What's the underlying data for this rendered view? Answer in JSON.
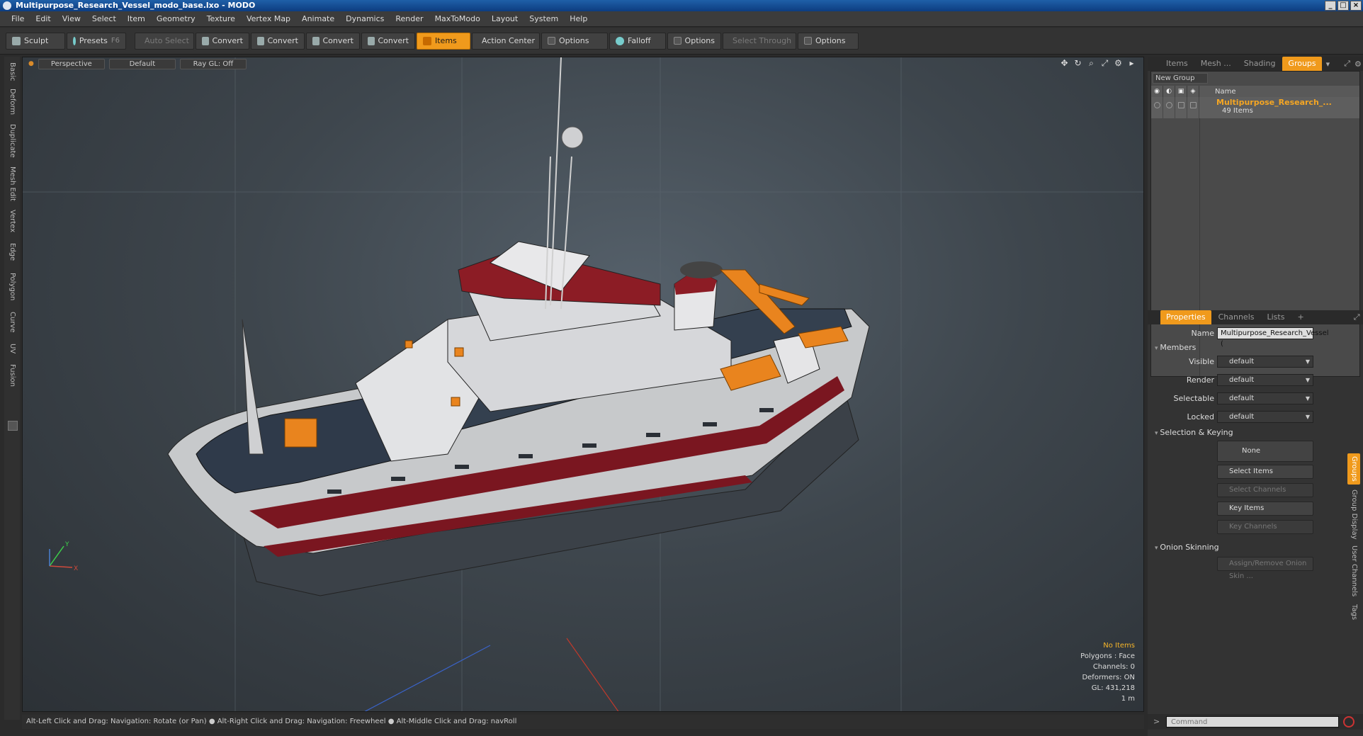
{
  "window": {
    "title": "Multipurpose_Research_Vessel_modo_base.lxo - MODO"
  },
  "menu": [
    "File",
    "Edit",
    "View",
    "Select",
    "Item",
    "Geometry",
    "Texture",
    "Vertex Map",
    "Animate",
    "Dynamics",
    "Render",
    "MaxToModo",
    "Layout",
    "System",
    "Help"
  ],
  "toolbar": {
    "sculpt": "Sculpt",
    "presets": "Presets",
    "presets_key": "F6",
    "auto_select": "Auto Select",
    "convert": "Convert",
    "items": "Items",
    "action_center": "Action Center",
    "options": "Options",
    "falloff": "Falloff",
    "select_through": "Select Through"
  },
  "left_tabs": [
    "Basic",
    "Deform",
    "Duplicate",
    "Mesh Edit",
    "Vertex",
    "Edge",
    "Polygon",
    "Curve",
    "UV",
    "Fusion"
  ],
  "viewport": {
    "view_mode": "Perspective",
    "shading": "Default",
    "raygl": "Ray GL: Off",
    "stats": {
      "selection": "No Items",
      "polygons": "Polygons : Face",
      "channels": "Channels: 0",
      "deformers": "Deformers: ON",
      "gl": "GL: 431,218",
      "scale": "1 m"
    }
  },
  "status": "Alt-Left Click and Drag: Navigation: Rotate (or Pan) ● Alt-Right Click and Drag: Navigation: Freewheel ● Alt-Middle Click and Drag: navRoll",
  "top_tabs": [
    "Items",
    "Mesh ...",
    "Shading",
    "Groups"
  ],
  "groups": {
    "new_group": "New Group",
    "col_name": "Name",
    "item_name": "Multipurpose_Research_...",
    "item_count": "49 Items"
  },
  "prop_tabs": [
    "Properties",
    "Channels",
    "Lists",
    "+"
  ],
  "properties": {
    "name_label": "Name",
    "name_value": "Multipurpose_Research_Vessel (",
    "members_section": "Members",
    "visible_label": "Visible",
    "render_label": "Render",
    "selectable_label": "Selectable",
    "locked_label": "Locked",
    "default_value": "default",
    "selection_section": "Selection & Keying",
    "none_btn": "None",
    "select_items_btn": "Select Items",
    "select_channels_btn": "Select Channels",
    "key_items_btn": "Key Items",
    "key_channels_btn": "Key Channels",
    "onion_section": "Onion Skinning",
    "onion_btn": "Assign/Remove Onion Skin ..."
  },
  "right_side_tabs": [
    "Groups",
    "Group Display",
    "User Channels",
    "Tags"
  ],
  "command": {
    "placeholder": "Command"
  },
  "colors": {
    "accent": "#f09a1c",
    "highlight_text": "#f5a623",
    "hull_red": "#7a1620",
    "hull_white": "#d8d8d8"
  }
}
